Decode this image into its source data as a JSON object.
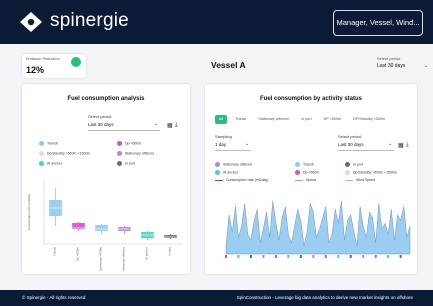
{
  "header": {
    "brand": "spinergie",
    "search_label": "Manager, Vessel, Wind..."
  },
  "emission": {
    "title": "Emission Reduction",
    "value": "12%"
  },
  "vessel": {
    "name": "Vessel A"
  },
  "top_period": {
    "label": "Select period",
    "value": "Last 30 days"
  },
  "left_card": {
    "title": "Fuel consumption analysis",
    "period_label": "Select period",
    "period_value": "Last 30 days",
    "legend": [
      {
        "label": "Transit",
        "color": "#8ec9ef"
      },
      {
        "label": "Dp >500m",
        "color": "#d94fd3"
      },
      {
        "label": "Dp/standby >500m <1500m",
        "color": "#ead1ee"
      },
      {
        "label": "Stationary offshore",
        "color": "#b484e0"
      },
      {
        "label": "At anchor",
        "color": "#3fd8b6"
      },
      {
        "label": "In port",
        "color": "#6b6b6b"
      }
    ]
  },
  "right_card": {
    "title": "Fuel consumption by activity status",
    "tabs": [
      "All",
      "Transit",
      "Stationary offshore",
      "In port",
      "DP >500m",
      "DP/Standby >500m"
    ],
    "sampling_label": "Sampling",
    "sampling_value": "1 day",
    "period_label": "Select period",
    "period_value": "Last 30 days",
    "legend": [
      {
        "label": "Stationary offshore",
        "color": "#b484e0",
        "kind": "dot"
      },
      {
        "label": "Transit",
        "color": "#8ec9ef",
        "kind": "dot"
      },
      {
        "label": "In port",
        "color": "#6b6b6b",
        "kind": "dot"
      },
      {
        "label": "At anchor",
        "color": "#3fd8b6",
        "kind": "dot"
      },
      {
        "label": "Dp >500m",
        "color": "#d94fd3",
        "kind": "dot"
      },
      {
        "label": "Dp/Standby >500m <1500m",
        "color": "#ead1ee",
        "kind": "dot"
      },
      {
        "label": "Consumption rate (m3/day)",
        "color": "#c0392b",
        "kind": "line"
      },
      {
        "label": "Speed",
        "color": "#e58aa3",
        "kind": "line"
      },
      {
        "label": "Wind Speed",
        "color": "#c4a0e4",
        "kind": "line"
      }
    ]
  },
  "chart_data": {
    "type": "box",
    "ylabel": "Consumption rate (m3/day)",
    "categories": [
      "Transit",
      "Dp >500m",
      "Dp/standby >500m",
      "Stationary offshore",
      "At anchor",
      "In port"
    ],
    "colors": [
      "#8ec9ef",
      "#d94fd3",
      "#8ec9ef",
      "#b484e0",
      "#3fd8b6",
      "#6b6b6b"
    ],
    "stats": [
      {
        "min": 9,
        "q1": 14,
        "median": 18,
        "q3": 22,
        "max": 28
      },
      {
        "min": 6.5,
        "q1": 7.5,
        "median": 8,
        "q3": 10.5,
        "max": 11
      },
      {
        "min": 5,
        "q1": 6.5,
        "median": 7.5,
        "q3": 9.5,
        "max": 10
      },
      {
        "min": 5,
        "q1": 6.5,
        "median": 7.5,
        "q3": 8.5,
        "max": 9
      },
      {
        "min": 2,
        "q1": 3,
        "median": 4.5,
        "q3": 6,
        "max": 6.5
      },
      {
        "min": 2.5,
        "q1": 3,
        "median": 3.5,
        "q3": 4.5,
        "max": 5
      }
    ],
    "ylim": [
      0,
      32
    ]
  },
  "activity_series": [
    3,
    14,
    8,
    17,
    6,
    10,
    18,
    7,
    5,
    12,
    16,
    4,
    9,
    15,
    6,
    19,
    11,
    5,
    13,
    17,
    7,
    4,
    10,
    16,
    12,
    3,
    8,
    18,
    15,
    6,
    9,
    13,
    17,
    4,
    7,
    16,
    11,
    19,
    5,
    12,
    14,
    8,
    3,
    17,
    10,
    6,
    15,
    13,
    4,
    18,
    9,
    11,
    7,
    16,
    5,
    14,
    12,
    17,
    6,
    10
  ],
  "footer": {
    "left": "© Spinergie - All rights reserved",
    "right": "SpinConstruction - Leverage big data analytics to derive new market insights on offshore"
  }
}
